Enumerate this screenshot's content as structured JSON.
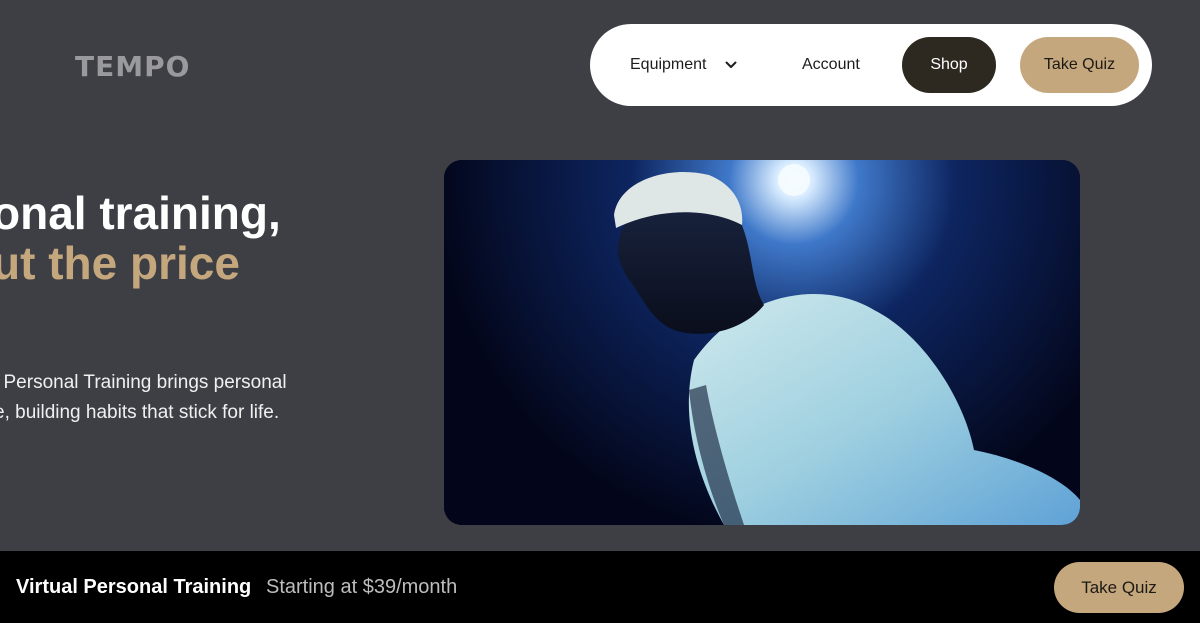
{
  "brand": {
    "logo_text": "TEMPO"
  },
  "nav": {
    "items": [
      {
        "label": "Equipment",
        "has_dropdown": true,
        "icon": "chevron-down-icon"
      },
      {
        "label": "Account"
      }
    ],
    "shop_label": "Shop",
    "quiz_label": "Take Quiz"
  },
  "hero": {
    "title_line1": "onal training,",
    "title_line2": "ut the price",
    "description_line1": "l Personal Training brings personal",
    "description_line2": "e, building habits that stick for life.",
    "media": "video of trainer in white t-shirt under spotlight"
  },
  "bottom_bar": {
    "title": "Virtual Personal Training",
    "price_text": "Starting at $39/month",
    "cta_label": "Take Quiz"
  },
  "colors": {
    "background": "#3e3f45",
    "accent_gold": "#c5a77e",
    "shop_button": "#2d2920",
    "bottom_bar": "#000000"
  }
}
